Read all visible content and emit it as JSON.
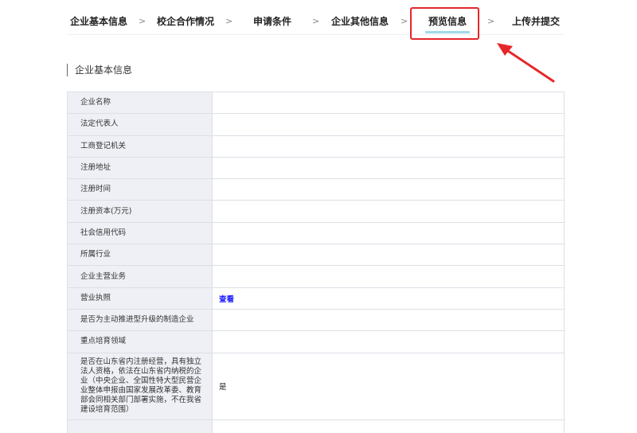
{
  "steps": [
    {
      "label": "企业基本信息"
    },
    {
      "label": "校企合作情况"
    },
    {
      "label": "申请条件"
    },
    {
      "label": "企业其他信息"
    },
    {
      "label": "预览信息"
    },
    {
      "label": "上传并提交"
    }
  ],
  "separator": ">",
  "active_step": "预览信息",
  "section": {
    "title": "企业基本信息"
  },
  "rows": [
    {
      "label": "企业名称",
      "value": ""
    },
    {
      "label": "法定代表人",
      "value": ""
    },
    {
      "label": "工商登记机关",
      "value": ""
    },
    {
      "label": "注册地址",
      "value": ""
    },
    {
      "label": "注册时间",
      "value": ""
    },
    {
      "label": "注册资本(万元)",
      "value": ""
    },
    {
      "label": "社会信用代码",
      "value": ""
    },
    {
      "label": "所属行业",
      "value": ""
    },
    {
      "label": "企业主营业务",
      "value": ""
    },
    {
      "label": "营业执照",
      "link": "查看"
    },
    {
      "label": "是否为主动推进型升级的制造企业",
      "value": ""
    },
    {
      "label": "重点培育领域",
      "value": ""
    },
    {
      "label": "是否在山东省内注册经营，具有独立法人资格，依法在山东省内纳税的企业（中央企业、全国性特大型民营企业整体申报由国家发展改革委、教育部会同相关部门部署实施，不在我省建设培育范围）",
      "value": "是"
    }
  ],
  "colors": {
    "accent_red": "#e5272a",
    "active_underline": "#9fd9ea",
    "link": "#1a1aff"
  }
}
